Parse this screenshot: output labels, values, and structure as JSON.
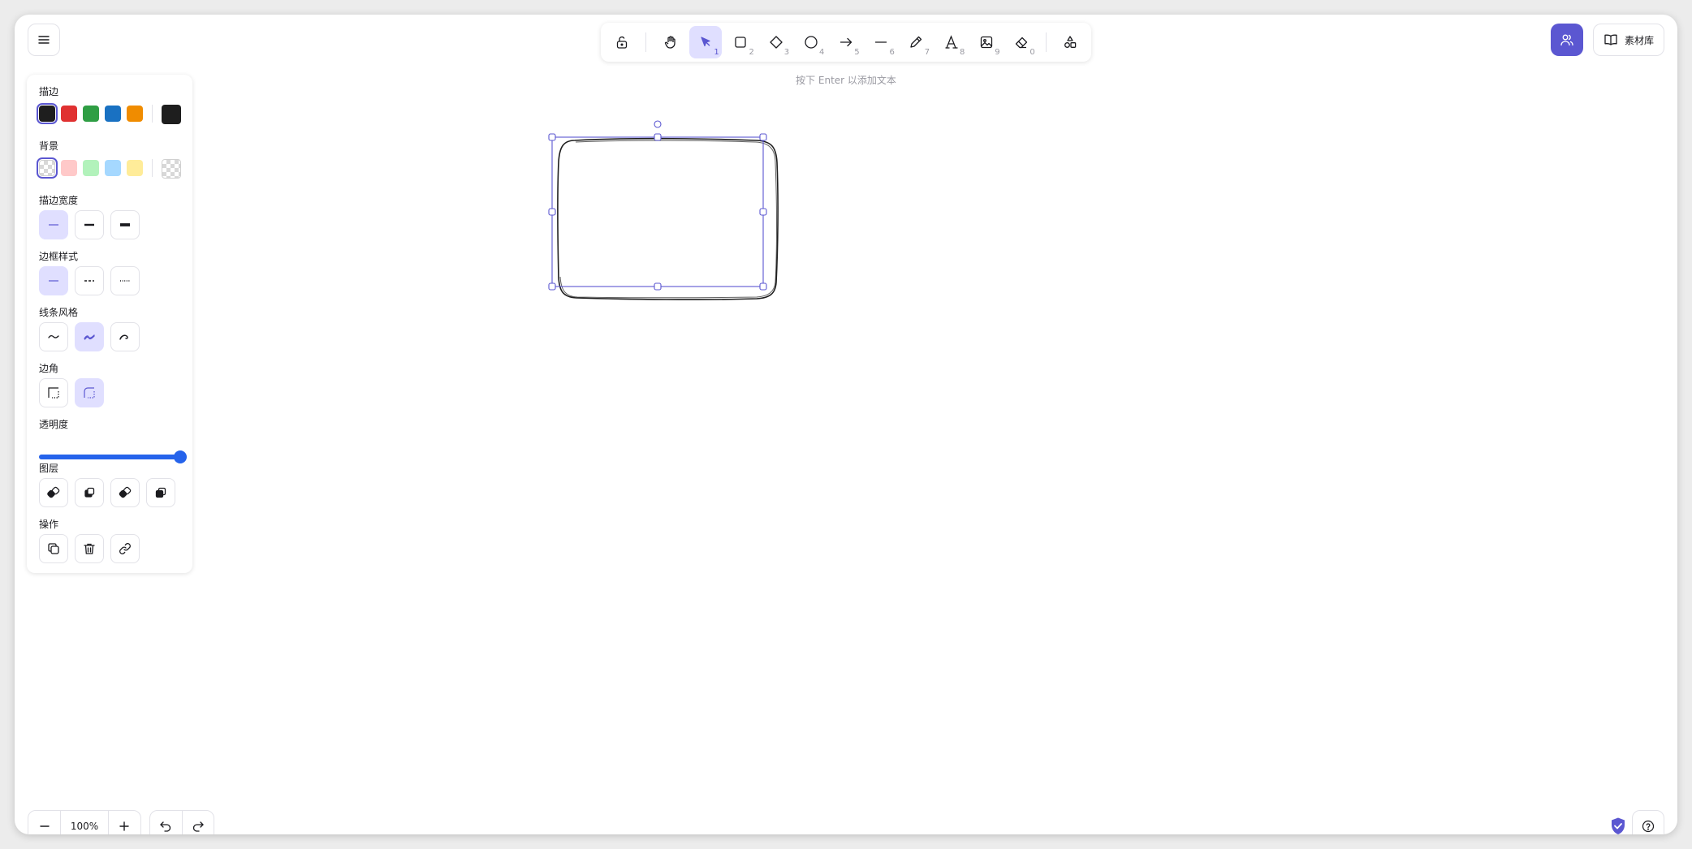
{
  "toolbar": {
    "tools": [
      {
        "name": "lock",
        "key": ""
      },
      {
        "name": "hand",
        "key": ""
      },
      {
        "name": "select",
        "key": "1"
      },
      {
        "name": "rectangle",
        "key": "2"
      },
      {
        "name": "diamond",
        "key": "3"
      },
      {
        "name": "ellipse",
        "key": "4"
      },
      {
        "name": "arrow",
        "key": "5"
      },
      {
        "name": "line",
        "key": "6"
      },
      {
        "name": "pencil",
        "key": "7"
      },
      {
        "name": "text",
        "key": "8"
      },
      {
        "name": "image",
        "key": "9"
      },
      {
        "name": "eraser",
        "key": "0"
      },
      {
        "name": "more-shapes",
        "key": ""
      }
    ],
    "active_tool": "select"
  },
  "hint": "按下 Enter 以添加文本",
  "header": {
    "library_label": "素材库"
  },
  "panel": {
    "stroke": {
      "title": "描边",
      "colors": [
        "#1e1e1e",
        "#e03131",
        "#2f9e44",
        "#1971c2",
        "#f08c00"
      ],
      "selected": "#1e1e1e",
      "current": "#1e1e1e"
    },
    "background": {
      "title": "背景",
      "colors": [
        "transparent",
        "#ffc9c9",
        "#b2f2bb",
        "#a5d8ff",
        "#ffec99"
      ],
      "selected": "transparent",
      "current": "transparent"
    },
    "stroke_width": {
      "title": "描边宽度",
      "options": [
        "thin",
        "bold",
        "extra-bold"
      ],
      "selected": "thin"
    },
    "stroke_style": {
      "title": "边框样式",
      "options": [
        "solid",
        "dashed",
        "dotted"
      ],
      "selected": "solid"
    },
    "sloppiness": {
      "title": "线条风格",
      "options": [
        "architect",
        "artist",
        "cartoonist"
      ],
      "selected": "artist"
    },
    "edges": {
      "title": "边角",
      "options": [
        "sharp",
        "round"
      ],
      "selected": "round"
    },
    "opacity": {
      "title": "透明度",
      "value": 100
    },
    "layers": {
      "title": "图层",
      "actions": [
        "send-to-back",
        "send-backward",
        "bring-forward",
        "bring-to-front"
      ]
    },
    "actions": {
      "title": "操作",
      "items": [
        "duplicate",
        "delete",
        "link"
      ]
    }
  },
  "footer": {
    "zoom": "100%"
  },
  "colors": {
    "accent": "#5b57d1",
    "accent_light": "#e0dfff",
    "slider": "#2563eb"
  }
}
